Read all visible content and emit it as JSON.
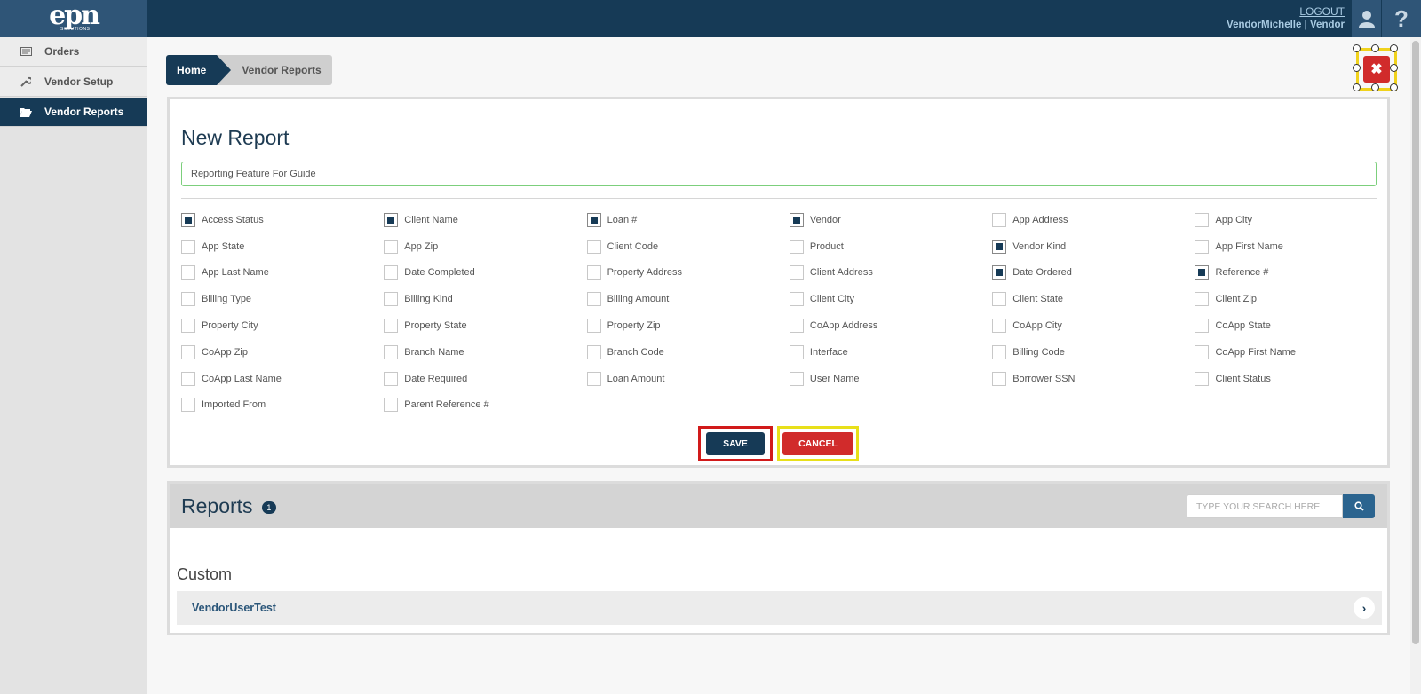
{
  "header": {
    "logo_text": "epn",
    "logo_subtext": "SOLUTIONS",
    "logout_label": "LOGOUT",
    "user_name": "VendorMichelle",
    "user_role": "Vendor",
    "user_separator": "|"
  },
  "sidebar": {
    "items": [
      {
        "label": "Orders",
        "icon": "orders-icon",
        "active": false
      },
      {
        "label": "Vendor Setup",
        "icon": "wrench-icon",
        "active": false
      },
      {
        "label": "Vendor Reports",
        "icon": "folder-open-icon",
        "active": true
      }
    ]
  },
  "breadcrumb": {
    "home": "Home",
    "current": "Vendor Reports"
  },
  "new_report": {
    "title": "New Report",
    "name_value": "Reporting Feature For Guide",
    "fields": [
      {
        "label": "Access Status",
        "checked": true
      },
      {
        "label": "Client Name",
        "checked": true
      },
      {
        "label": "Loan #",
        "checked": true
      },
      {
        "label": "Vendor",
        "checked": true
      },
      {
        "label": "App Address",
        "checked": false
      },
      {
        "label": "App City",
        "checked": false
      },
      {
        "label": "App State",
        "checked": false
      },
      {
        "label": "App Zip",
        "checked": false
      },
      {
        "label": "Client Code",
        "checked": false
      },
      {
        "label": "Product",
        "checked": false
      },
      {
        "label": "Vendor Kind",
        "checked": true
      },
      {
        "label": "App First Name",
        "checked": false
      },
      {
        "label": "App Last Name",
        "checked": false
      },
      {
        "label": "Date Completed",
        "checked": false
      },
      {
        "label": "Property Address",
        "checked": false
      },
      {
        "label": "Client Address",
        "checked": false
      },
      {
        "label": "Date Ordered",
        "checked": true
      },
      {
        "label": "Reference #",
        "checked": true
      },
      {
        "label": "Billing Type",
        "checked": false
      },
      {
        "label": "Billing Kind",
        "checked": false
      },
      {
        "label": "Billing Amount",
        "checked": false
      },
      {
        "label": "Client City",
        "checked": false
      },
      {
        "label": "Client State",
        "checked": false
      },
      {
        "label": "Client Zip",
        "checked": false
      },
      {
        "label": "Property City",
        "checked": false
      },
      {
        "label": "Property State",
        "checked": false
      },
      {
        "label": "Property Zip",
        "checked": false
      },
      {
        "label": "CoApp Address",
        "checked": false
      },
      {
        "label": "CoApp City",
        "checked": false
      },
      {
        "label": "CoApp State",
        "checked": false
      },
      {
        "label": "CoApp Zip",
        "checked": false
      },
      {
        "label": "Branch Name",
        "checked": false
      },
      {
        "label": "Branch Code",
        "checked": false
      },
      {
        "label": "Interface",
        "checked": false
      },
      {
        "label": "Billing Code",
        "checked": false
      },
      {
        "label": "CoApp First Name",
        "checked": false
      },
      {
        "label": "CoApp Last Name",
        "checked": false
      },
      {
        "label": "Date Required",
        "checked": false
      },
      {
        "label": "Loan Amount",
        "checked": false
      },
      {
        "label": "User Name",
        "checked": false
      },
      {
        "label": "Borrower SSN",
        "checked": false
      },
      {
        "label": "Client Status",
        "checked": false
      },
      {
        "label": "Imported From",
        "checked": false
      },
      {
        "label": "Parent Reference #",
        "checked": false
      }
    ],
    "save_label": "SAVE",
    "cancel_label": "CANCEL"
  },
  "reports": {
    "title": "Reports",
    "count": "1",
    "search_placeholder": "TYPE YOUR SEARCH HERE",
    "group_label": "Custom",
    "items": [
      {
        "name": "VendorUserTest"
      }
    ]
  },
  "colors": {
    "navy": "#163a56",
    "red": "#d12b2b",
    "highlight_red": "#d11a1a",
    "highlight_yellow": "#e8e01a"
  }
}
